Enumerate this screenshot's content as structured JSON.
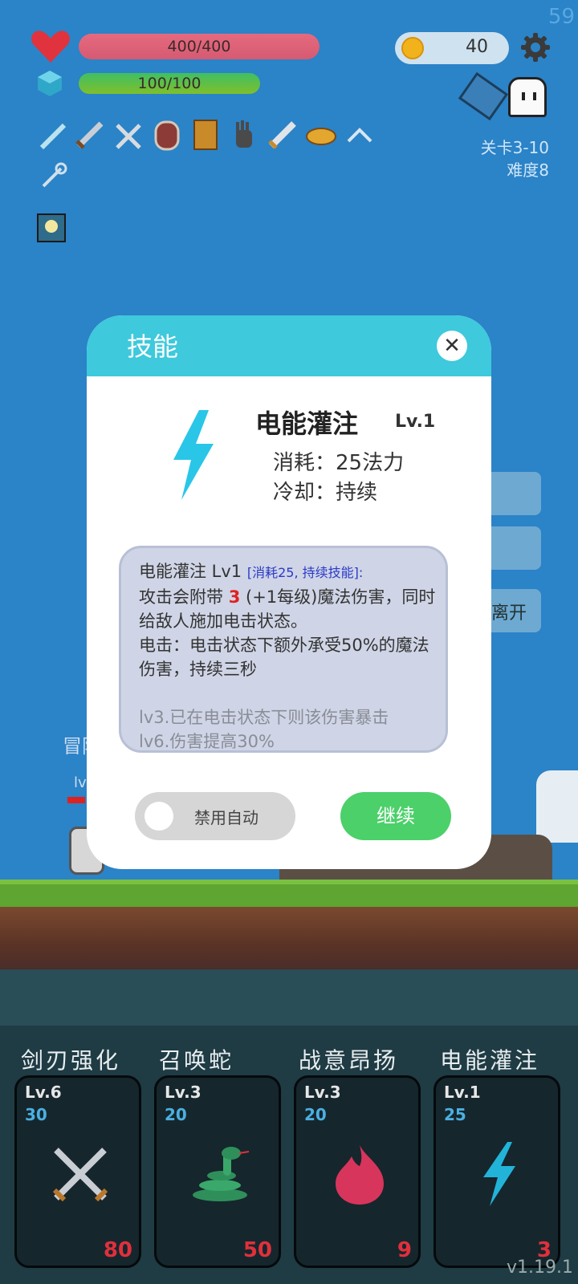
{
  "hud": {
    "fps": "59",
    "hp": "400/400",
    "mp": "100/100",
    "coins": "40",
    "stage": "关卡3-10",
    "difficulty": "难度8"
  },
  "dialog": {
    "title": "技能",
    "close": "✕",
    "skill_name": "电能灌注",
    "skill_level": "Lv.1",
    "cost": "消耗：25法力",
    "cooldown": "冷却：持续",
    "desc_name": "电能灌注 Lv1",
    "desc_tag": "[消耗25, 持续技能]:",
    "desc_line1a": "攻击会附带",
    "desc_num": "3",
    "desc_line1b": "(+1每级)魔法伤害，同时给敌人施加电击状态。",
    "desc_line2": "电击：电击状态下额外承受50%的魔法伤害，持续三秒",
    "desc_lv3": "lv3.已在电击状态下则该伤害暴击",
    "desc_lv6": "lv6.伤害提高30%",
    "toggle_label": "禁用自动",
    "toggle_on": false,
    "continue": "继续"
  },
  "background": {
    "side_button_label": "离开",
    "adventurer_text": "冒险",
    "adventurer_lv": "lv"
  },
  "skills": [
    {
      "name": "剑刃强化",
      "level": "Lv.6",
      "mana": "30",
      "count": "80",
      "icon": "crossed-swords-icon"
    },
    {
      "name": "召唤蛇",
      "level": "Lv.3",
      "mana": "20",
      "count": "50",
      "icon": "snake-icon"
    },
    {
      "name": "战意昂扬",
      "level": "Lv.3",
      "mana": "20",
      "count": "9",
      "icon": "flame-icon"
    },
    {
      "name": "电能灌注",
      "level": "Lv.1",
      "mana": "25",
      "count": "3",
      "icon": "lightning-icon"
    }
  ],
  "version": "v1.19.1",
  "colors": {
    "sky": "#2b83c8",
    "dialog_header": "#3ec9dc",
    "continue": "#4cd06a",
    "hp": "#e66a7e",
    "mp": "#3fbf64"
  }
}
